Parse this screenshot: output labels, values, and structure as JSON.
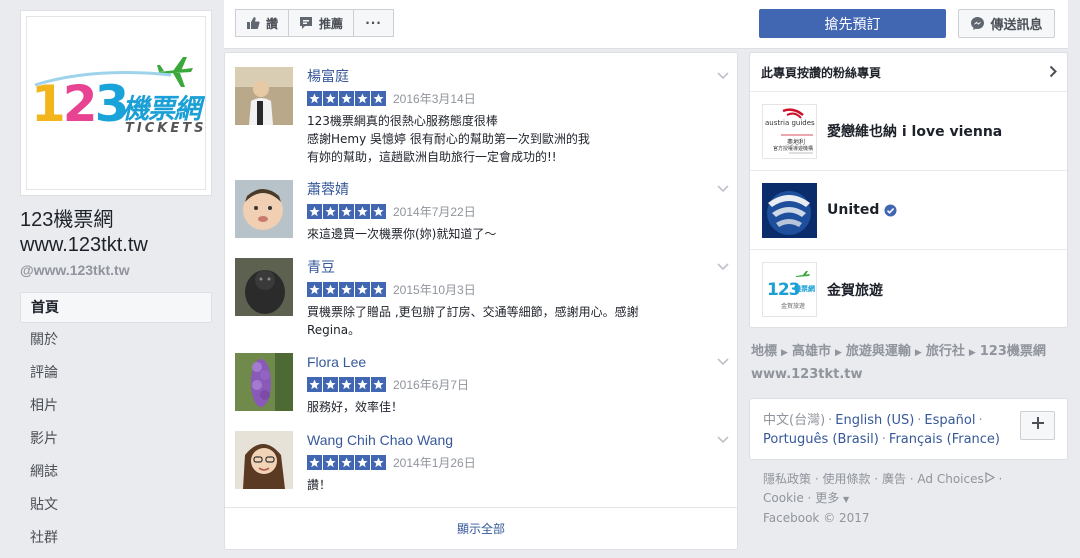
{
  "page": {
    "name_line1": "123機票網",
    "name_line2": "www.123tkt.tw",
    "handle": "@www.123tkt.tw",
    "logo": {
      "digits": [
        "1",
        "2",
        "3"
      ],
      "cn": "機票網",
      "sub": "TICKETS"
    }
  },
  "nav": [
    {
      "label": "首頁",
      "active": true
    },
    {
      "label": "關於"
    },
    {
      "label": "評論"
    },
    {
      "label": "相片"
    },
    {
      "label": "影片"
    },
    {
      "label": "網誌"
    },
    {
      "label": "貼文"
    },
    {
      "label": "社群"
    }
  ],
  "actions": {
    "like": "讚",
    "recommend": "推薦",
    "more": "···",
    "book": "搶先預訂",
    "message": "傳送訊息"
  },
  "reviews": [
    {
      "name": "楊富庭",
      "stars": 5,
      "date": "2016年3月14日",
      "lines": [
        "123機票網真的很熱心服務態度很棒",
        "感謝Hemy 吳憶婷 很有耐心的幫助第一次到歐洲的我",
        "有妳的幫助，這趟歐洲自助旅行一定會成功的!!"
      ]
    },
    {
      "name": "蕭蓉婧",
      "stars": 5,
      "date": "2014年7月22日",
      "lines": [
        "來這邊買一次機票你(妳)就知道了～"
      ]
    },
    {
      "name": "青豆",
      "stars": 5,
      "date": "2015年10月3日",
      "lines": [
        "買機票除了贈品 ,更包辦了訂房、交通等細節，感謝用心。感謝",
        "Regina。"
      ]
    },
    {
      "name": "Flora Lee",
      "stars": 5,
      "date": "2016年6月7日",
      "lines": [
        "服務好，效率佳！"
      ]
    },
    {
      "name": "Wang Chih Chao Wang",
      "stars": 5,
      "date": "2014年1月26日",
      "lines": [
        "讚！"
      ]
    }
  ],
  "show_all": "顯示全部",
  "liked": {
    "heading": "此專頁按讚的粉絲專頁",
    "items": [
      {
        "name": "愛戀維也納 i love vienna",
        "verified": false,
        "thumb_text": [
          "austria guides",
          "奧地利",
          "官方授權導遊機構"
        ]
      },
      {
        "name": "United",
        "verified": true
      },
      {
        "name": "金賀旅遊",
        "verified": false,
        "thumb_text": [
          "123",
          "機票網",
          "金賀旅遊"
        ]
      }
    ]
  },
  "breadcrumb": [
    "地標",
    "高雄市",
    "旅遊與運輸",
    "旅行社",
    "123機票網www.123tkt.tw"
  ],
  "languages": {
    "current": "中文(台灣)",
    "others": [
      "English (US)",
      "Español",
      "Português (Brasil)",
      "Français (France)"
    ]
  },
  "footer": {
    "links": [
      "隱私政策",
      "使用條款",
      "廣告",
      "Ad Choices",
      "Cookie",
      "更多"
    ],
    "copyright": "Facebook © 2017"
  },
  "colors": {
    "fb_blue": "#4267b2",
    "link": "#365899",
    "bg": "#e9ebee"
  }
}
